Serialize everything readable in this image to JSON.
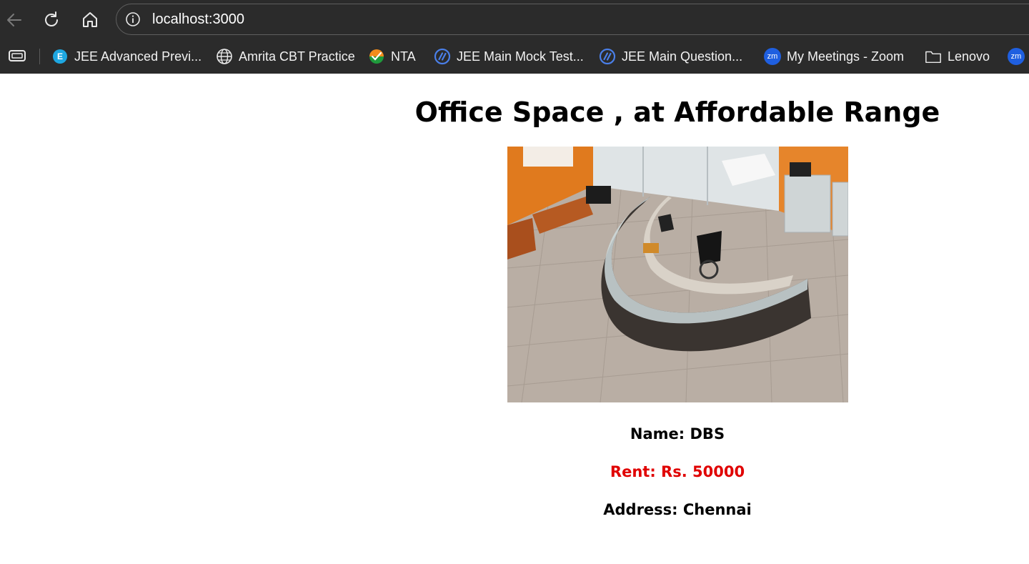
{
  "browser": {
    "url": "localhost:3000",
    "bookmarks": [
      {
        "label": "JEE Advanced Previ...",
        "icon": "e-logo-icon"
      },
      {
        "label": "Amrita CBT Practice",
        "icon": "globe-icon"
      },
      {
        "label": "NTA",
        "icon": "nta-logo-icon"
      },
      {
        "label": "JEE Main Mock Test...",
        "icon": "slash-circle-icon"
      },
      {
        "label": "JEE Main Question...",
        "icon": "slash-circle-icon"
      },
      {
        "label": "My Meetings - Zoom",
        "icon": "zoom-logo-icon"
      },
      {
        "label": "Lenovo",
        "icon": "folder-icon"
      }
    ],
    "icon_e_letter": "E",
    "icon_zoom_text": "zm"
  },
  "page": {
    "title": "Office Space , at Affordable Range",
    "photo_description_alt": "",
    "name_text": "Name: DBS",
    "rent_text": "Rent: Rs. 50000",
    "address_text": "Address: Chennai"
  },
  "colors": {
    "chrome_bg": "#2b2b2b",
    "rent": "#e00000",
    "text": "#000000"
  }
}
